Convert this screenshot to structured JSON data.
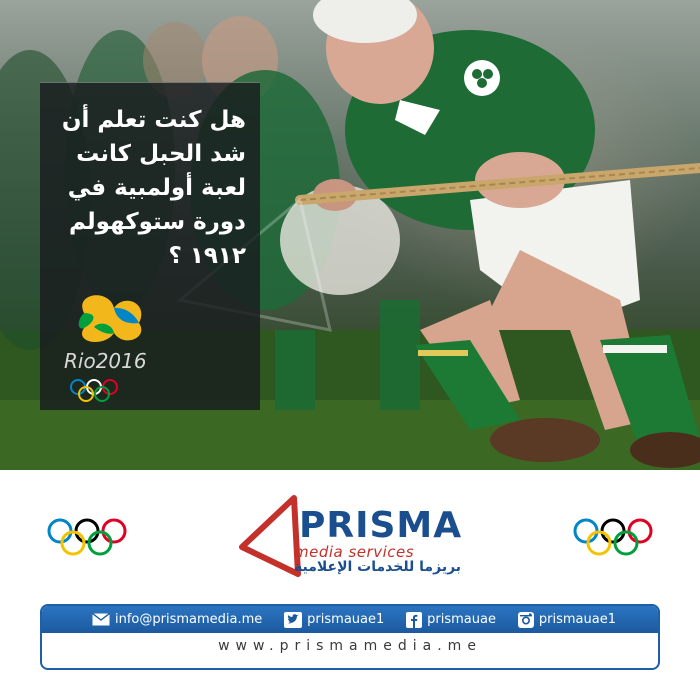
{
  "photo": {
    "description_icon": "tug-of-war-photo",
    "shirt_color": "#1e6b35",
    "rope_color": "#c9a66b"
  },
  "info": {
    "lines": [
      "هل كنت تعلم أن",
      "شد الحبل كانت",
      "لعبة أولمبية في",
      "دورة ستوكهولم",
      "١٩١٢ ؟"
    ],
    "logo_text": "Rio2016"
  },
  "brand": {
    "name": "PRISMA",
    "tagline": "media services",
    "arabic": "بريزما للخدمات الإعلامية",
    "primary_color": "#1b4e8e",
    "accent_color": "#c4312a"
  },
  "contact": {
    "email": "info@prismamedia.me",
    "twitter": "prismauae1",
    "facebook": "prismauae",
    "instagram": "prismauae1",
    "website": "www.prismamedia.me"
  },
  "rings_colors": [
    "#0085c7",
    "#f4c300",
    "#000000",
    "#009f3d",
    "#df0024"
  ]
}
